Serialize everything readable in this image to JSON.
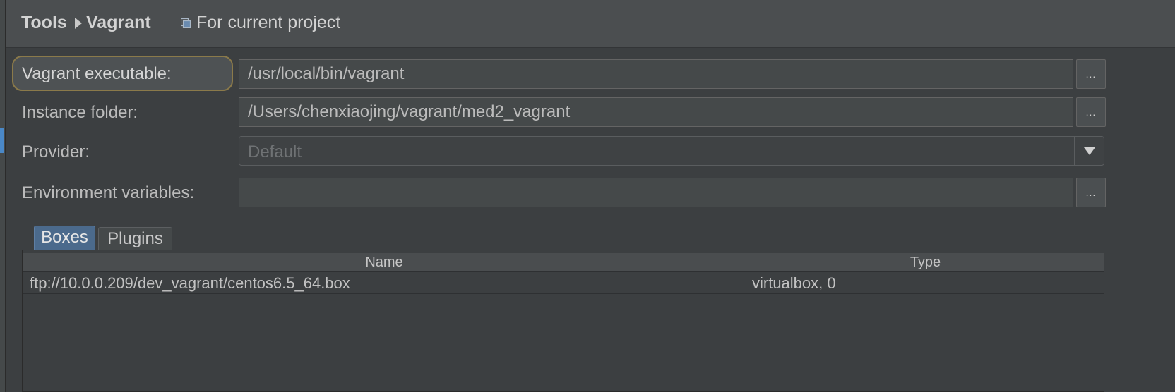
{
  "breadcrumb": {
    "root": "Tools",
    "current": "Vagrant",
    "scope_label": "For current project"
  },
  "form": {
    "executable_label": "Vagrant executable:",
    "executable_value": "/usr/local/bin/vagrant",
    "instance_label": "Instance folder:",
    "instance_value": "/Users/chenxiaojing/vagrant/med2_vagrant",
    "provider_label": "Provider:",
    "provider_value": "Default",
    "env_label": "Environment variables:",
    "env_value": "",
    "browse_label": "..."
  },
  "tabs": [
    {
      "label": "Boxes",
      "active": true
    },
    {
      "label": "Plugins",
      "active": false
    }
  ],
  "boxes_table": {
    "columns": [
      "Name",
      "Type"
    ],
    "rows": [
      {
        "name": "ftp://10.0.0.209/dev_vagrant/centos6.5_64.box",
        "type": "virtualbox, 0"
      }
    ]
  },
  "colors": {
    "background": "#3c3f41",
    "header": "#4b4e50",
    "active_tab": "#4b6a8c",
    "focus_border": "#8b7a4a"
  }
}
